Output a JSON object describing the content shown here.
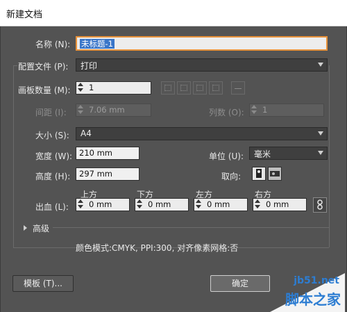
{
  "window": {
    "title": "新建文档"
  },
  "name": {
    "label": "名称 (N):",
    "value": "未标题-1"
  },
  "profile": {
    "label": "配置文件 (P):",
    "value": "打印"
  },
  "artboards": {
    "label": "画板数量 (M):",
    "value": "1"
  },
  "spacing": {
    "label": "间距 (I):",
    "value": "7.06 mm"
  },
  "columns": {
    "label": "列数 (O):",
    "value": "1"
  },
  "size": {
    "label": "大小 (S):",
    "value": "A4"
  },
  "width": {
    "label": "宽度 (W):",
    "value": "210 mm"
  },
  "units": {
    "label": "单位 (U):",
    "value": "毫米"
  },
  "height": {
    "label": "高度 (H):",
    "value": "297 mm"
  },
  "orientation": {
    "label": "取向:"
  },
  "bleed": {
    "label": "出血 (L):",
    "top": {
      "label": "上方",
      "value": "0 mm"
    },
    "bottom": {
      "label": "下方",
      "value": "0 mm"
    },
    "left": {
      "label": "左方",
      "value": "0 mm"
    },
    "right": {
      "label": "右方",
      "value": "0 mm"
    }
  },
  "advanced": {
    "label": "高级"
  },
  "summary": "颜色模式:CMYK, PPI:300, 对齐像素网格:否",
  "buttons": {
    "template": "模板 (T)...",
    "ok": "确定"
  },
  "watermark": {
    "site": "jb51.net",
    "name": "脚本之家"
  },
  "colors": {
    "accent": "#e8923a",
    "selection": "#3a76c9",
    "background": "#535353"
  }
}
